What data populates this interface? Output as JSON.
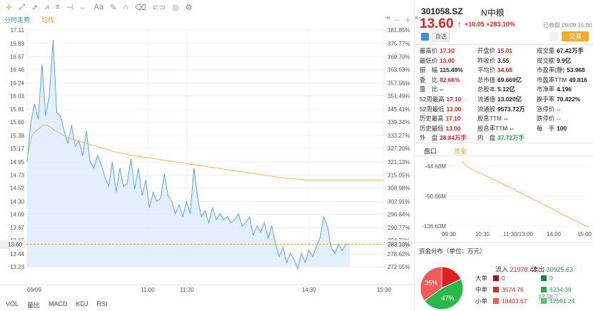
{
  "toolbar": {
    "icons": [
      "crosshair-icon",
      "line-draw-icon",
      "ray-icon",
      "polyline-icon",
      "fib-icon",
      "arrow-back-icon",
      "text-icon",
      "pencil-icon",
      "magnet-icon",
      "delete-icon",
      "link-icon",
      "layers-icon",
      "settings-icon"
    ],
    "text_tool": "Aa"
  },
  "chart_tabs": {
    "minute": "分时走势",
    "avg": "均线"
  },
  "chart_controls": [
    "⇥",
    "－",
    "＋",
    "⇤"
  ],
  "bottom_tabs": [
    "VOL",
    "量比",
    "MACD",
    "KDJ",
    "RSI"
  ],
  "chart_data": {
    "type": "line",
    "title": "",
    "y_price_ticks": [
      "17.11",
      "16.89",
      "16.67",
      "16.46",
      "16.24",
      "16.03",
      "15.81",
      "15.60",
      "15.38",
      "15.17",
      "14.95",
      "14.73",
      "14.52",
      "14.30",
      "14.09",
      "13.87",
      "13.66",
      "13.44",
      "13.23"
    ],
    "y_pct_ticks": [
      "381.85%",
      "375.77%",
      "369.70%",
      "363.63%",
      "357.56%",
      "351.49%",
      "345.41%",
      "339.34%",
      "333.27%",
      "327.20%",
      "321.13%",
      "315.05%",
      "308.98%",
      "302.91%",
      "296.84%",
      "290.77%",
      "284.70%",
      "278.62%",
      "272.55%"
    ],
    "x_ticks": [
      "09/09",
      "11:00",
      "11:30",
      "14:30",
      "15:30"
    ],
    "current_price_label": "13.60",
    "current_pct_label": "283.10%",
    "series": [
      {
        "name": "分时走势",
        "color": "#5ea1ef",
        "values": [
          14.95,
          15.6,
          15.9,
          15.65,
          16.55,
          15.7,
          16.05,
          16.95,
          15.75,
          15.7,
          15.45,
          15.25,
          15.55,
          15.2,
          15.3,
          15.05,
          15.45,
          14.95,
          14.85,
          15.05,
          14.9,
          14.7,
          14.55,
          14.95,
          14.45,
          14.85,
          14.55,
          14.6,
          15.0,
          14.5,
          14.85,
          14.4,
          14.65,
          14.2,
          14.45,
          14.3,
          14.35,
          14.75,
          14.4,
          14.3,
          14.1,
          14.25,
          14.05,
          14.3,
          14.1,
          14.85,
          14.35,
          14.05,
          14.15,
          13.95,
          14.2,
          14.0,
          14.1,
          14.0,
          14.05,
          13.95,
          14.0,
          14.1,
          13.9,
          13.95,
          14.05,
          13.75,
          13.9,
          13.8,
          13.95,
          13.7,
          13.9,
          13.6,
          13.4,
          13.55,
          13.3,
          13.45,
          13.35,
          13.2,
          13.45,
          13.3,
          13.5,
          13.4,
          13.55,
          13.7,
          14.05,
          13.9,
          13.55,
          13.45,
          13.6,
          13.5,
          13.6,
          13.6
        ]
      },
      {
        "name": "均线",
        "color": "#f0b45a",
        "values": [
          15.0,
          15.35,
          15.45,
          15.5,
          15.55,
          15.55,
          15.5,
          15.45,
          15.42,
          15.38,
          15.35,
          15.32,
          15.3,
          15.28,
          15.26,
          15.24,
          15.22,
          15.2,
          15.18,
          15.16,
          15.14,
          15.12,
          15.1,
          15.09,
          15.08,
          15.06,
          15.05,
          15.04,
          15.03,
          15.02,
          15.01,
          15.0,
          14.99,
          14.98,
          14.97,
          14.96,
          14.95,
          14.94,
          14.93,
          14.92,
          14.91,
          14.9,
          14.89,
          14.88,
          14.87,
          14.86,
          14.85,
          14.84,
          14.83,
          14.82,
          14.81,
          14.8,
          14.79,
          14.78,
          14.77,
          14.76,
          14.75,
          14.74,
          14.73,
          14.72,
          14.71,
          14.7,
          14.69,
          14.68,
          14.68,
          14.67,
          14.66,
          14.66,
          14.65,
          14.65,
          14.65,
          14.65,
          14.65,
          14.65,
          14.65,
          14.65,
          14.65,
          14.65,
          14.65,
          14.65,
          14.65,
          14.65,
          14.65,
          14.65,
          14.65,
          14.65,
          14.65,
          14.65
        ]
      }
    ]
  },
  "stock": {
    "code": "301058.SZ",
    "name": "N中粮",
    "price": "13.60",
    "arrow": "↑",
    "change": "+10.05 +283.10%",
    "date": "已收盘 09/09 15:00",
    "watch_label": "自选",
    "trade_label": "交易"
  },
  "quote_rows": [
    [
      [
        "最高价",
        "17.10",
        "red"
      ],
      [
        "开盘价",
        "15.01",
        "red"
      ],
      [
        "成交量",
        "67.42万手",
        "black"
      ]
    ],
    [
      [
        "最低价",
        "13.00",
        "red"
      ],
      [
        "昨收价",
        "3.55",
        "black"
      ],
      [
        "成交额",
        "9.9亿",
        "black"
      ]
    ],
    [
      [
        "振　幅",
        "115.49%",
        "black"
      ],
      [
        "平均价",
        "14.68",
        "red"
      ],
      [
        "市盈率(静)",
        "53.968",
        "black"
      ]
    ],
    [
      [
        "委　比",
        "82.66%",
        "red"
      ],
      [
        "总市值",
        "69.669亿",
        "black"
      ],
      [
        "市盈率TTM",
        "49.816",
        "black"
      ]
    ],
    [
      [
        "量　比",
        "--",
        "black"
      ],
      [
        "总股本",
        "5.12亿",
        "black"
      ],
      [
        "市净率",
        "4.196",
        "black"
      ]
    ],
    [
      [
        "52周最高",
        "17.10",
        "red"
      ],
      [
        "流通值",
        "13.020亿",
        "black"
      ],
      [
        "换手率",
        "70.422%",
        "black"
      ]
    ],
    [
      [
        "52周最低",
        "13.00",
        "red"
      ],
      [
        "流通股",
        "9573.72万",
        "black"
      ],
      [
        "涨停价",
        "--",
        "red"
      ]
    ],
    [
      [
        "历史最高",
        "17.10",
        "red"
      ],
      [
        "股息TTM",
        "--",
        "black"
      ],
      [
        "跌停价",
        "--",
        "green"
      ]
    ],
    [
      [
        "历史最低",
        "13.00",
        "red"
      ],
      [
        "股息率TTM",
        "--",
        "black"
      ],
      [
        "每　手",
        "100",
        "black"
      ]
    ],
    [
      [
        "外　盘",
        "28.84万手",
        "red"
      ],
      [
        "内　盘",
        "37.72万手",
        "green"
      ],
      [
        "",
        "",
        " black"
      ]
    ]
  ],
  "fund_tabs": {
    "a": "盘口",
    "b": "资金"
  },
  "fund_chart": {
    "type": "line",
    "y_ticks": [
      "-44.68M",
      "-90.66M",
      "-136.63M"
    ],
    "x_ticks": [
      "09:30",
      "10:30",
      "11:30/13:00",
      "14:00",
      "15:00"
    ],
    "values": [
      -38,
      -42,
      -47,
      -50,
      -52,
      -55,
      -57,
      -60,
      -62,
      -65,
      -68,
      -70,
      -73,
      -76,
      -78,
      -81,
      -84,
      -86,
      -89,
      -92,
      -95,
      -97,
      -100,
      -103,
      -106,
      -108,
      -111,
      -114,
      -117,
      -120,
      -122,
      -125,
      -128,
      -130,
      -133,
      -136,
      -139
    ]
  },
  "distribution": {
    "title": "资金分布（单位：万元）",
    "in_label": "流入",
    "in_value": "21978.43",
    "out_label": "流出",
    "out_value": "30925.63",
    "pie": [
      {
        "label": "18%",
        "value": 18,
        "color": "#e02020"
      },
      {
        "label": "47%",
        "value": 47,
        "color": "#2bb84a"
      },
      {
        "label": "35%",
        "value": 35,
        "color": "#f05a5a"
      }
    ],
    "rows": [
      {
        "label": "大单",
        "in": "0",
        "out": "0",
        "in_color": "#b01010",
        "out_color": "#138a35"
      },
      {
        "label": "中单",
        "in": "3574.76",
        "out": "6234.39",
        "in_color": "#d03030",
        "out_color": "#22a845"
      },
      {
        "label": "小单",
        "in": "18403.67",
        "out": "12691.24",
        "in_color": "#f05a5a",
        "out_color": "#4cc96a"
      }
    ]
  },
  "watermark": "格隆汇"
}
